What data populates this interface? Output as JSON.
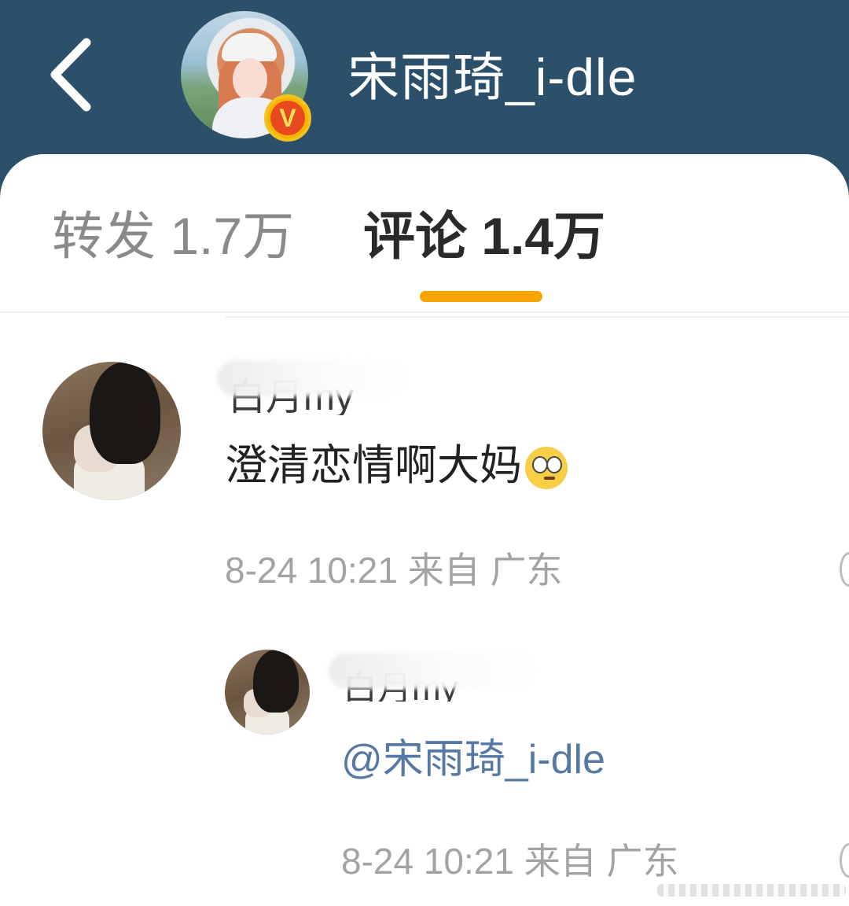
{
  "header": {
    "title": "宋雨琦_i-dle",
    "verified_badge": "V"
  },
  "tabs": [
    {
      "label": "转发 1.7万",
      "active": false
    },
    {
      "label": "评论 1.4万",
      "active": true
    }
  ],
  "accent_color": "#f5a400",
  "comment": {
    "username": "白月my",
    "text": "澄清恋情啊大妈",
    "emoji": "face-with-rolling-eyes-icon",
    "time": "8-24 10:21",
    "source_label": "来自",
    "location": "广东"
  },
  "reply": {
    "username": "白月my",
    "mention": "@宋雨琦_i-dle",
    "time": "8-24 10:21",
    "source_label": "来自",
    "location": "广东"
  }
}
